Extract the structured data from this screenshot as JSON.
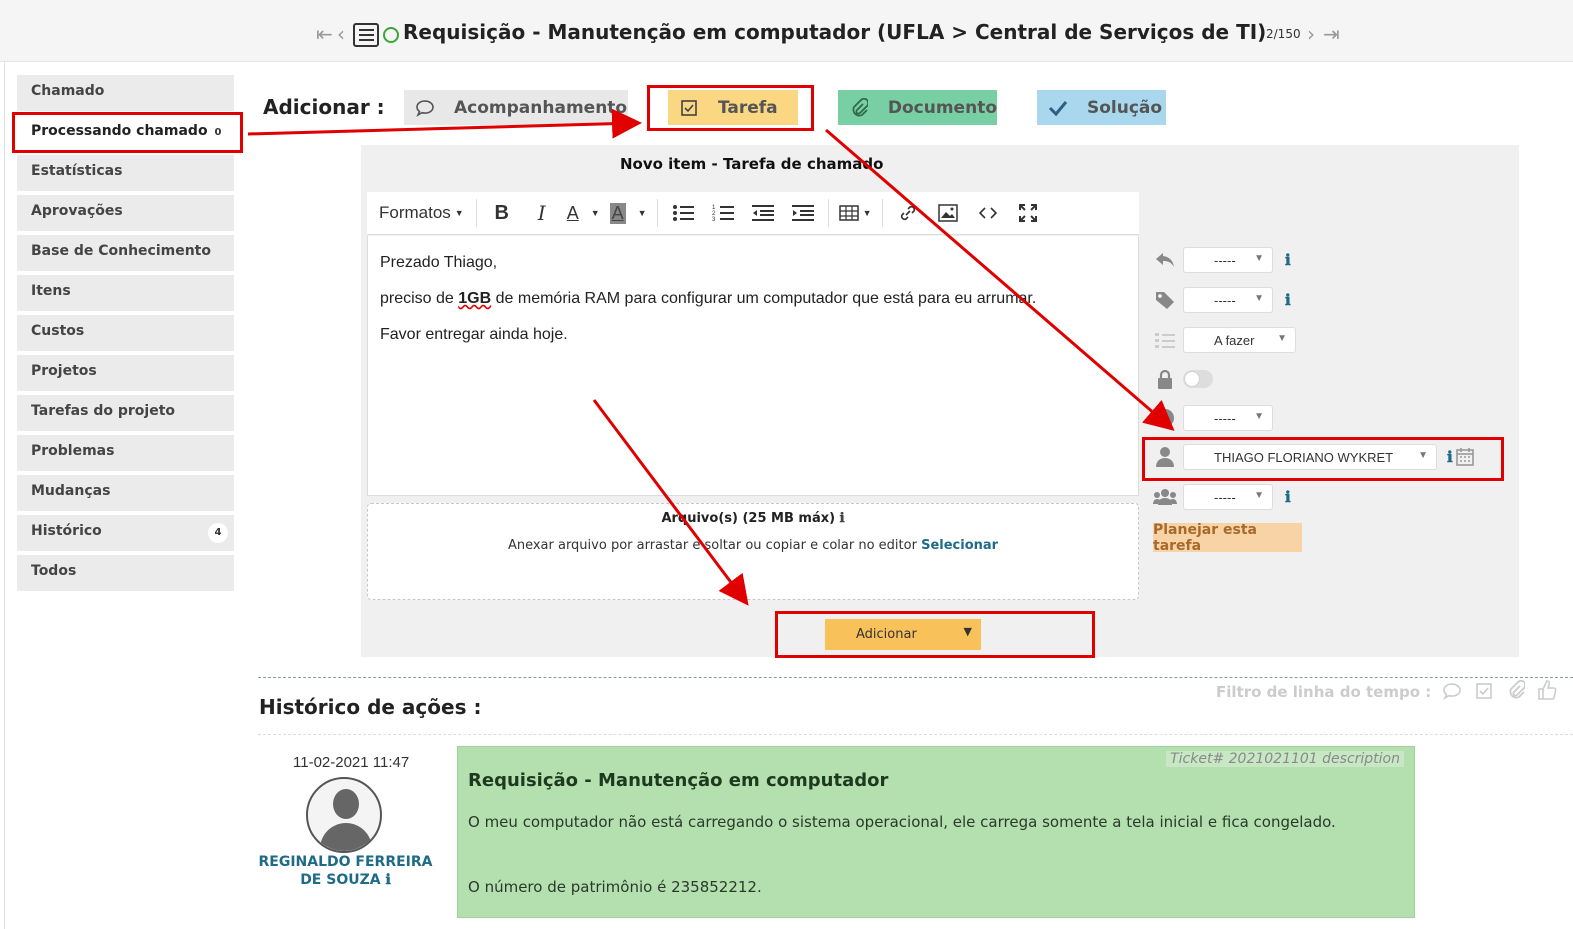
{
  "header": {
    "first_icon": "⇤",
    "prev_icon": "‹",
    "next_icon": "›",
    "last_icon": "⇥",
    "title": "Requisição - Manutenção em computador (UFLA > Central de Serviços de TI)",
    "counter": "2/150",
    "status_color": "#3aa63a"
  },
  "sidebar": {
    "items": [
      {
        "label": "Chamado",
        "count": null
      },
      {
        "label": "Processando chamado",
        "count": "0"
      },
      {
        "label": "Estatísticas",
        "count": null
      },
      {
        "label": "Aprovações",
        "count": null
      },
      {
        "label": "Base de Conhecimento",
        "count": null
      },
      {
        "label": "Itens",
        "count": null
      },
      {
        "label": "Custos",
        "count": null
      },
      {
        "label": "Projetos",
        "count": null
      },
      {
        "label": "Tarefas do projeto",
        "count": null
      },
      {
        "label": "Problemas",
        "count": null
      },
      {
        "label": "Mudanças",
        "count": null
      },
      {
        "label": "Histórico",
        "count": "4"
      },
      {
        "label": "Todos",
        "count": null
      }
    ]
  },
  "add_row": {
    "label": "Adicionar :",
    "followup": "Acompanhamento",
    "task": "Tarefa",
    "document": "Documento",
    "solution": "Solução"
  },
  "form": {
    "title": "Novo item - Tarefa de chamado",
    "toolbar": {
      "formats": "Formatos",
      "bold": "B",
      "italic": "I",
      "font_color": "A",
      "bg_color": "A"
    },
    "body": {
      "line1": "Prezado Thiago,",
      "line2_pre": "preciso de ",
      "line2_bold": "1GB",
      "line2_post": " de memória RAM para configurar um computador que está para eu arrumar.",
      "line3": "Favor entregar ainda hoje."
    },
    "files": {
      "title": "Arquivo(s) (25 MB máx)",
      "hint": "Anexar arquivo por arrastar e soltar ou copiar e colar no editor ",
      "select": "Selecionar"
    },
    "submit": "Adicionar",
    "submit_caret": "▼"
  },
  "fields": {
    "template": "-----",
    "category": "-----",
    "status": "A fazer",
    "duration": "-----",
    "technician": "THIAGO FLORIANO WYKRET",
    "group": "-----",
    "plan_button": "Planejar esta tarefa"
  },
  "history": {
    "title": "Histórico de ações :",
    "filter_label": "Filtro de linha do tempo :",
    "date": "11-02-2021 11:47",
    "author_line1": "REGINALDO FERREIRA",
    "author_line2": "DE SOUZA",
    "ticket_ref": "Ticket# 2021021101 description",
    "card_title": "Requisição - Manutenção em computador",
    "card_line1": "O meu computador não está carregando o sistema operacional, ele carrega somente a tela inicial e fica congelado.",
    "card_line2": "O número de patrimônio é 235852212."
  },
  "colors": {
    "annotation_red": "#e00000",
    "task_tab": "#fcd783",
    "document_tab": "#79cfa4",
    "solution_tab": "#a8d7ee",
    "history_card": "#b4e0b0",
    "link": "#1f6b87"
  }
}
